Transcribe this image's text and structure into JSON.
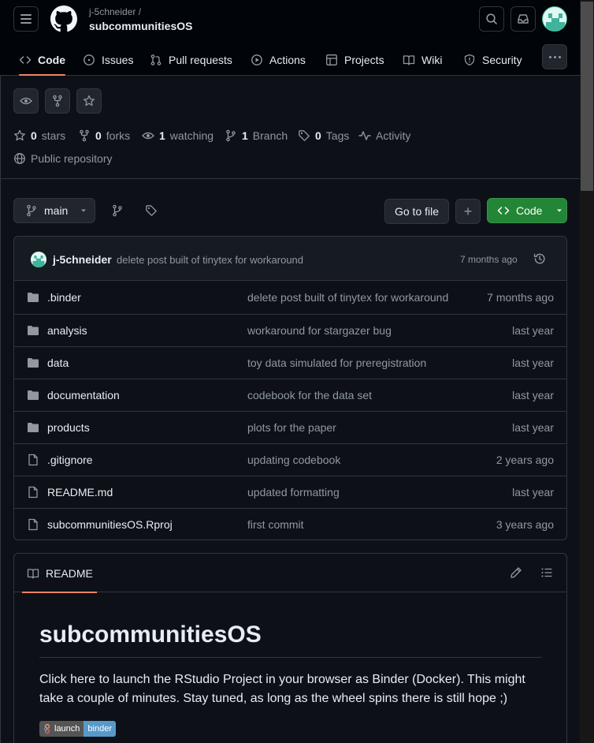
{
  "header": {
    "owner": "j-5chneider /",
    "repo": "subcommunitiesOS"
  },
  "tabs": [
    {
      "label": "Code"
    },
    {
      "label": "Issues"
    },
    {
      "label": "Pull requests"
    },
    {
      "label": "Actions"
    },
    {
      "label": "Projects"
    },
    {
      "label": "Wiki"
    },
    {
      "label": "Security"
    }
  ],
  "stats": {
    "stars_count": "0",
    "stars_label": "stars",
    "forks_count": "0",
    "forks_label": "forks",
    "watching_count": "1",
    "watching_label": "watching",
    "branch_count": "1",
    "branch_label": "Branch",
    "tags_count": "0",
    "tags_label": "Tags",
    "activity_label": "Activity",
    "visibility": "Public repository"
  },
  "toolbar": {
    "branch": "main",
    "go_to_file": "Go to file",
    "add": "+",
    "code": "Code"
  },
  "latest_commit": {
    "author": "j-5chneider",
    "message": "delete post built of tinytex for workaround",
    "time": "7 months ago"
  },
  "files": [
    {
      "name": ".binder",
      "type": "folder",
      "message": "delete post built of tinytex for workaround",
      "date": "7 months ago"
    },
    {
      "name": "analysis",
      "type": "folder",
      "message": "workaround for stargazer bug",
      "date": "last year"
    },
    {
      "name": "data",
      "type": "folder",
      "message": "toy data simulated for preregistration",
      "date": "last year"
    },
    {
      "name": "documentation",
      "type": "folder",
      "message": "codebook for the data set",
      "date": "last year"
    },
    {
      "name": "products",
      "type": "folder",
      "message": "plots for the paper",
      "date": "last year"
    },
    {
      "name": ".gitignore",
      "type": "file",
      "message": "updating codebook",
      "date": "2 years ago"
    },
    {
      "name": "README.md",
      "type": "file",
      "message": "updated formatting",
      "date": "last year"
    },
    {
      "name": "subcommunitiesOS.Rproj",
      "type": "file",
      "message": "first commit",
      "date": "3 years ago"
    }
  ],
  "readme": {
    "tab_label": "README",
    "title": "subcommunitiesOS",
    "paragraph": "Click here to launch the RStudio Project in your browser as Binder (Docker). This might take a couple of minutes. Stay tuned, as long as the wheel spins there is still hope ;)",
    "badge_left": "launch",
    "badge_right": "binder"
  },
  "colors": {
    "accent": "#f78166",
    "green_button": "#238636",
    "binder_blue": "#579aca"
  }
}
